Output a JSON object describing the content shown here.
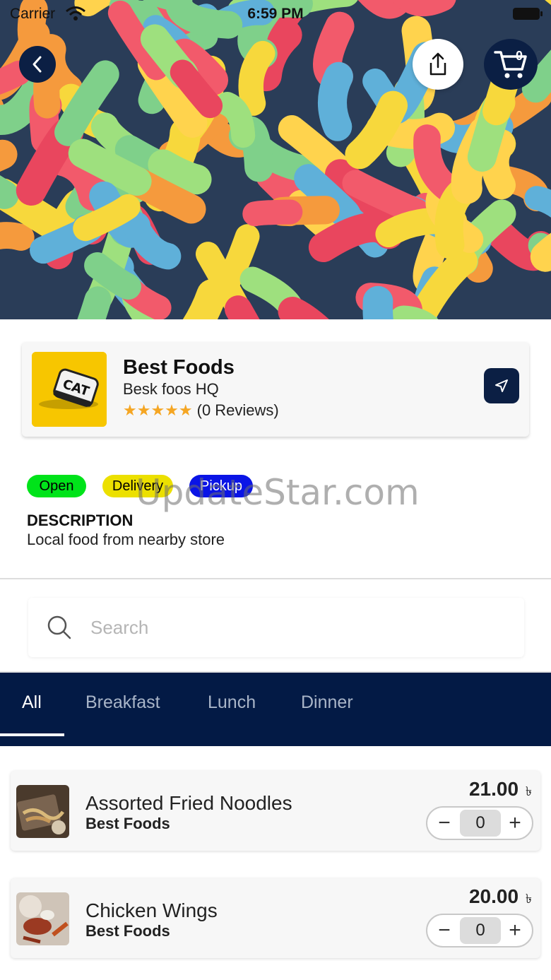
{
  "status_bar": {
    "carrier": "Carrier",
    "time": "6:59 PM"
  },
  "header": {
    "cart_count": "0"
  },
  "store": {
    "name": "Best Foods",
    "subtitle": "Besk foos HQ",
    "stars": "★★★★★",
    "reviews": "(0 Reviews)",
    "logo_text": "CAT"
  },
  "tags": {
    "open": "Open",
    "delivery": "Delivery",
    "pickup": "Pickup"
  },
  "watermark": "UpdateStar.com",
  "description": {
    "title": "DESCRIPTION",
    "text": "Local food from nearby store"
  },
  "search": {
    "placeholder": "Search",
    "value": ""
  },
  "tabs": [
    {
      "label": "All",
      "active": true
    },
    {
      "label": "Breakfast",
      "active": false
    },
    {
      "label": "Lunch",
      "active": false
    },
    {
      "label": "Dinner",
      "active": false
    }
  ],
  "products": [
    {
      "name": "Assorted Fried Noodles",
      "store": "Best Foods",
      "price": "21.00",
      "currency": "৳",
      "qty": "0"
    },
    {
      "name": "Chicken Wings",
      "store": "Best Foods",
      "price": "20.00",
      "currency": "৳",
      "qty": "0"
    }
  ],
  "colors": {
    "primary": "#031a45",
    "open": "#00e31a",
    "delivery": "#ece000",
    "pickup": "#0a14e6",
    "star": "#f5a623"
  },
  "icons": {
    "back": "chevron-left-icon",
    "share": "share-icon",
    "cart": "cart-icon",
    "navigate": "navigation-arrow-icon",
    "search": "search-icon",
    "minus": "minus-icon",
    "plus": "plus-icon"
  }
}
